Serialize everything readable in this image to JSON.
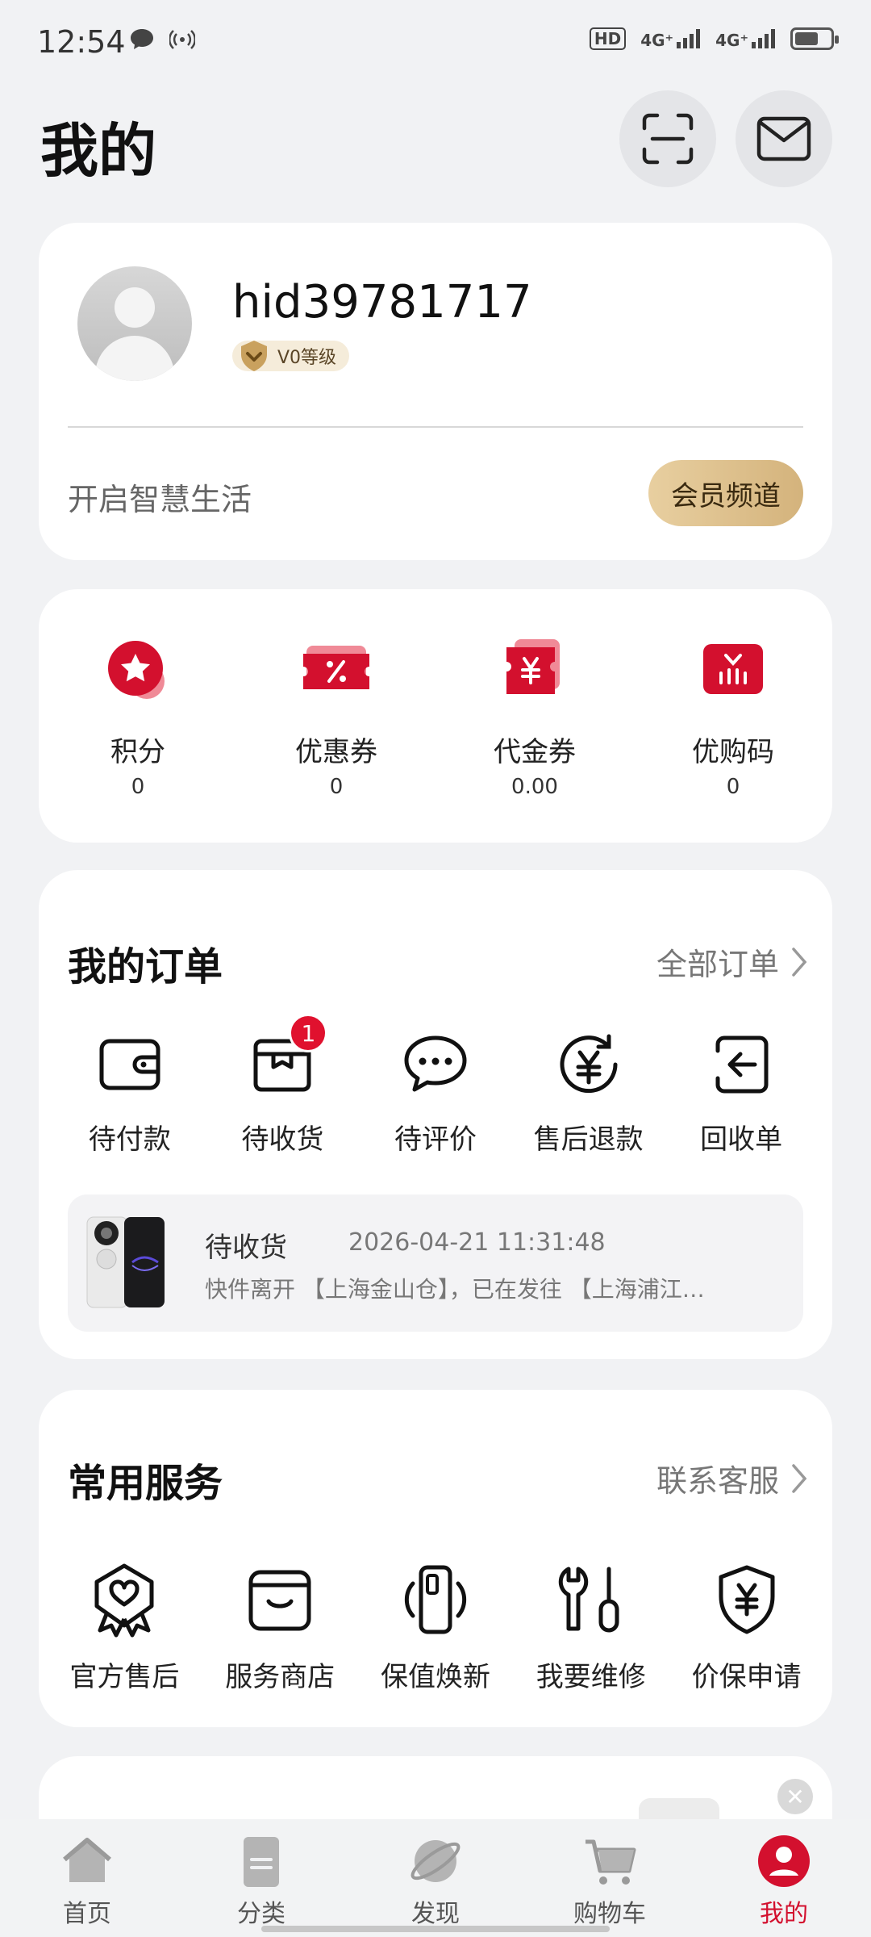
{
  "status_bar": {
    "time": "12:54",
    "network_1": "4G⁺",
    "network_2": "4G⁺",
    "hd_label": "HD"
  },
  "header": {
    "title": "我的"
  },
  "profile": {
    "username": "hid39781717",
    "level": "V0等级",
    "tagline": "开启智慧生活",
    "vip_button": "会员频道"
  },
  "assets": [
    {
      "label": "积分",
      "value": "0",
      "icon": "points-star-icon"
    },
    {
      "label": "优惠券",
      "value": "0",
      "icon": "coupon-icon"
    },
    {
      "label": "代金券",
      "value": "0.00",
      "icon": "voucher-yuan-icon"
    },
    {
      "label": "优购码",
      "value": "0",
      "icon": "promo-code-icon"
    }
  ],
  "orders": {
    "title": "我的订单",
    "all_link": "全部订单",
    "items": [
      {
        "label": "待付款",
        "icon": "wallet-icon",
        "badge": ""
      },
      {
        "label": "待收货",
        "icon": "box-icon",
        "badge": "1"
      },
      {
        "label": "待评价",
        "icon": "chat-bubble-icon",
        "badge": ""
      },
      {
        "label": "售后退款",
        "icon": "refund-yuan-icon",
        "badge": ""
      },
      {
        "label": "回收单",
        "icon": "recycle-return-icon",
        "badge": ""
      }
    ],
    "shipment": {
      "status": "待收货",
      "time": "2026-04-21 11:31:48",
      "detail": "快件离开 【上海金山仓】，已在发往 【上海浦江…"
    }
  },
  "services": {
    "title": "常用服务",
    "contact_link": "联系客服",
    "items": [
      {
        "label": "官方售后",
        "icon": "heart-badge-icon"
      },
      {
        "label": "服务商店",
        "icon": "store-icon"
      },
      {
        "label": "保值焕新",
        "icon": "phone-trade-in-icon"
      },
      {
        "label": "我要维修",
        "icon": "repair-tools-icon"
      },
      {
        "label": "价保申请",
        "icon": "price-protect-shield-icon"
      }
    ]
  },
  "tabs": [
    {
      "label": "首页",
      "icon": "home-icon",
      "active": false
    },
    {
      "label": "分类",
      "icon": "category-icon",
      "active": false
    },
    {
      "label": "发现",
      "icon": "discover-planet-icon",
      "active": false
    },
    {
      "label": "购物车",
      "icon": "cart-icon",
      "active": false
    },
    {
      "label": "我的",
      "icon": "profile-icon",
      "active": true
    }
  ],
  "colors": {
    "brand_red": "#d3102e",
    "vip_gold": "#d4b37c",
    "background": "#f1f2f4"
  }
}
